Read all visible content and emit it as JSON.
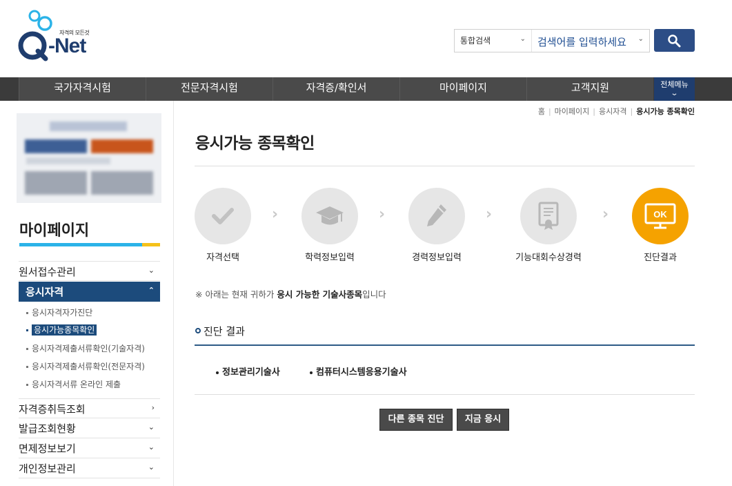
{
  "header": {
    "logo_tagline": "자격의 모든것",
    "logo_brand": "-Net",
    "logo_q": "Q",
    "search_scope": "통합검색",
    "search_placeholder": "검색어를 입력하세요",
    "search_button_icon": "search-icon"
  },
  "nav": {
    "items": [
      "국가자격시험",
      "전문자격시험",
      "자격증/확인서",
      "마이페이지",
      "고객지원"
    ],
    "all_menu": "전체메뉴"
  },
  "sidebar": {
    "title": "마이페이지",
    "menu": [
      {
        "label": "원서접수관리",
        "arrow": "⌄"
      },
      {
        "label": "응시자격",
        "arrow": "⌃"
      },
      {
        "label": "자격증취득조회",
        "arrow": "›"
      },
      {
        "label": "발급조회현황",
        "arrow": "⌄"
      },
      {
        "label": "면제정보보기",
        "arrow": "⌄"
      },
      {
        "label": "개인정보관리",
        "arrow": "⌄"
      }
    ],
    "submenu": [
      "응시자격자가진단",
      "응시가능종목확인",
      "응시자격제출서류확인(기술자격)",
      "응시자격제출서류확인(전문자격)",
      "응시자격서류 온라인 제출"
    ]
  },
  "breadcrumb": [
    "홈",
    "마이페이지",
    "응시자격",
    "응시가능 종목확인"
  ],
  "page_title": "응시가능 종목확인",
  "steps": [
    {
      "label": "자격선택",
      "icon": "check-icon"
    },
    {
      "label": "학력정보입력",
      "icon": "graduation-cap-icon"
    },
    {
      "label": "경력정보입력",
      "icon": "pencil-icon"
    },
    {
      "label": "기능대회수상경력",
      "icon": "certificate-icon"
    },
    {
      "label": "진단결과",
      "icon": "ok-monitor-icon",
      "ok_text": "OK"
    }
  ],
  "step_separator": "›",
  "notice": {
    "prefix": "※ 아래는 현재 귀하가 ",
    "highlight": "응시 가능한 기술사종목",
    "suffix": "입니다"
  },
  "result": {
    "title": "진단 결과",
    "items": [
      "정보관리기술사",
      "컴퓨터시스템응용기술사"
    ]
  },
  "buttons": {
    "other": "다른 종목 진단",
    "apply": "지금 응시"
  },
  "colors": {
    "brand_navy": "#1f3d6e",
    "active_menu": "#1c4b7c",
    "accent_orange": "#f5a200",
    "sidebar_bar_blue": "#2bb3e8",
    "sidebar_bar_yellow": "#f5c11a"
  }
}
